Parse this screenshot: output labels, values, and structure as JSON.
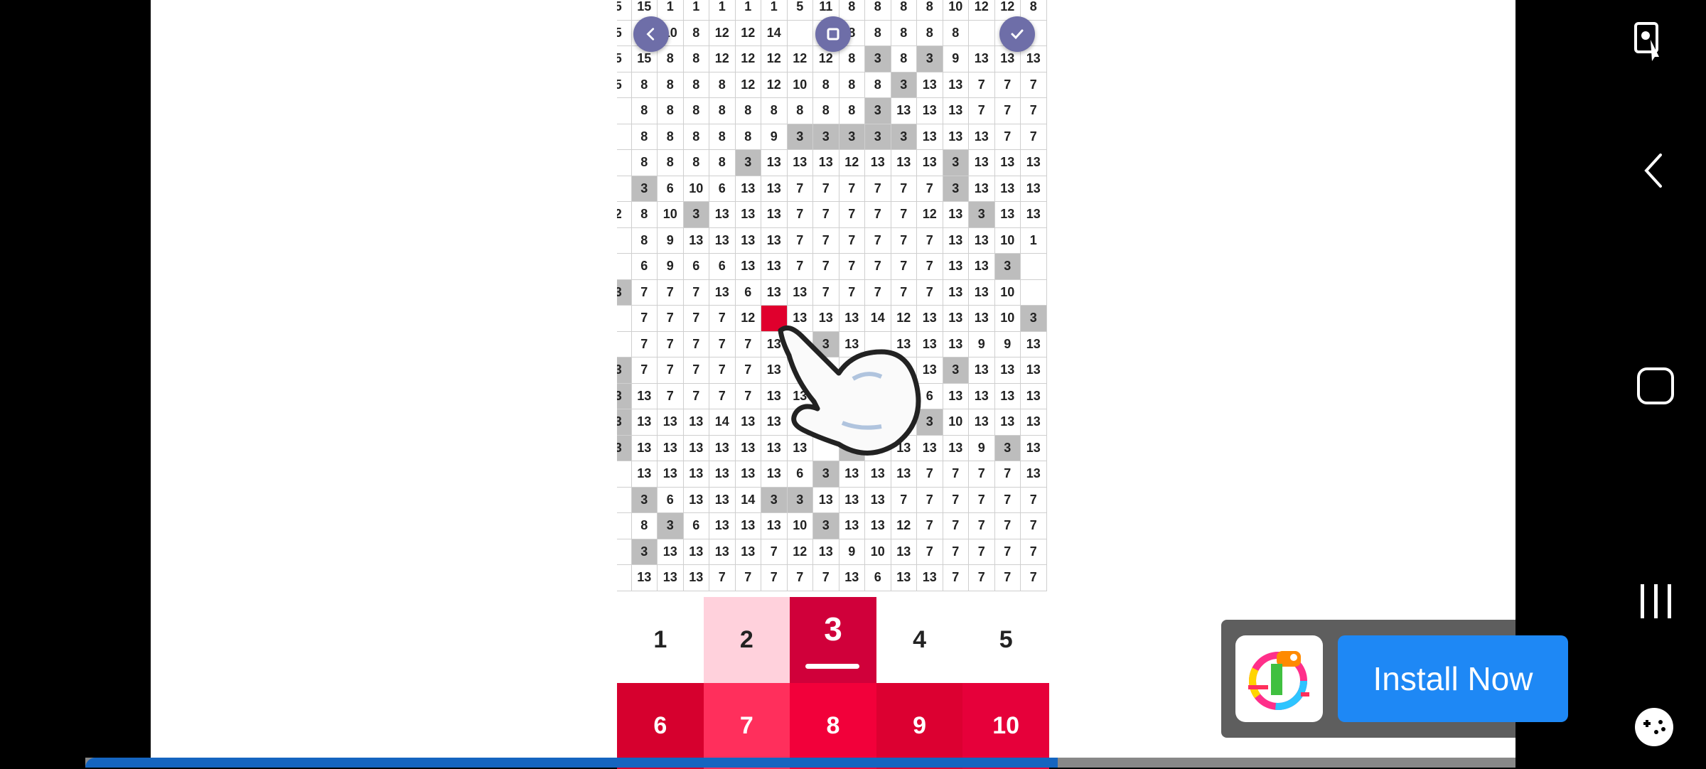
{
  "game": {
    "visible_columns": 17,
    "rows": [
      [
        "5",
        "15",
        "1",
        "1",
        "1",
        "1",
        "1",
        "5",
        "11",
        "8",
        "8",
        "8",
        "8",
        "10",
        "12",
        "12",
        "8"
      ],
      [
        "5",
        "",
        "10",
        "8",
        "12",
        "12",
        "14",
        "",
        "",
        "8",
        "8",
        "8",
        "8",
        "8",
        "",
        "",
        ""
      ],
      [
        "5",
        "15",
        "8",
        "8",
        "12",
        "12",
        "12",
        "12",
        "12",
        "8",
        "3",
        "8",
        "3",
        "9",
        "13",
        "13",
        "13"
      ],
      [
        "5",
        "8",
        "8",
        "8",
        "8",
        "12",
        "12",
        "10",
        "8",
        "8",
        "8",
        "3",
        "13",
        "13",
        "7",
        "7",
        "7"
      ],
      [
        "",
        "8",
        "8",
        "8",
        "8",
        "8",
        "8",
        "8",
        "8",
        "8",
        "3",
        "13",
        "13",
        "13",
        "7",
        "7",
        "7"
      ],
      [
        "",
        "8",
        "8",
        "8",
        "8",
        "8",
        "9",
        "3",
        "3",
        "3",
        "3",
        "3",
        "13",
        "13",
        "13",
        "7",
        "7"
      ],
      [
        "",
        "8",
        "8",
        "8",
        "8",
        "3",
        "13",
        "13",
        "13",
        "12",
        "13",
        "13",
        "13",
        "3",
        "13",
        "13",
        "13"
      ],
      [
        "",
        "3",
        "6",
        "10",
        "6",
        "13",
        "13",
        "7",
        "7",
        "7",
        "7",
        "7",
        "7",
        "3",
        "13",
        "13",
        "13"
      ],
      [
        "2",
        "8",
        "10",
        "3",
        "13",
        "13",
        "13",
        "7",
        "7",
        "7",
        "7",
        "7",
        "12",
        "13",
        "3",
        "13",
        "13"
      ],
      [
        "",
        "8",
        "9",
        "13",
        "13",
        "13",
        "13",
        "7",
        "7",
        "7",
        "7",
        "7",
        "7",
        "13",
        "13",
        "10",
        "1"
      ],
      [
        "",
        "6",
        "9",
        "6",
        "6",
        "13",
        "13",
        "7",
        "7",
        "7",
        "7",
        "7",
        "7",
        "13",
        "13",
        "3",
        ""
      ],
      [
        "3",
        "7",
        "7",
        "7",
        "13",
        "6",
        "13",
        "13",
        "7",
        "7",
        "7",
        "7",
        "7",
        "13",
        "13",
        "10",
        ""
      ],
      [
        "",
        "7",
        "7",
        "7",
        "7",
        "12",
        "",
        "13",
        "13",
        "13",
        "14",
        "12",
        "13",
        "13",
        "13",
        "10",
        "3"
      ],
      [
        "",
        "7",
        "7",
        "7",
        "7",
        "7",
        "13",
        "",
        "3",
        "13",
        "",
        "13",
        "13",
        "13",
        "9",
        "9",
        "13"
      ],
      [
        "3",
        "7",
        "7",
        "7",
        "7",
        "7",
        "13",
        "13",
        "",
        "",
        "",
        "13",
        "13",
        "3",
        "13",
        "13",
        "13"
      ],
      [
        "3",
        "13",
        "7",
        "7",
        "7",
        "7",
        "13",
        "13",
        "",
        "",
        "",
        "13",
        "6",
        "13",
        "13",
        "13",
        "13"
      ],
      [
        "3",
        "13",
        "13",
        "13",
        "14",
        "13",
        "13",
        "13",
        "",
        "",
        "",
        "13",
        "3",
        "10",
        "13",
        "13",
        "13"
      ],
      [
        "3",
        "13",
        "13",
        "13",
        "13",
        "13",
        "13",
        "13",
        "",
        "3",
        "",
        "13",
        "13",
        "13",
        "9",
        "3",
        "13"
      ],
      [
        "",
        "13",
        "13",
        "13",
        "13",
        "13",
        "13",
        "6",
        "3",
        "13",
        "13",
        "13",
        "7",
        "7",
        "7",
        "7",
        "13"
      ],
      [
        "",
        "3",
        "6",
        "13",
        "13",
        "14",
        "3",
        "3",
        "13",
        "13",
        "13",
        "7",
        "7",
        "7",
        "7",
        "7",
        "7"
      ],
      [
        "",
        "8",
        "3",
        "6",
        "13",
        "13",
        "13",
        "10",
        "3",
        "13",
        "13",
        "12",
        "7",
        "7",
        "7",
        "7",
        "7"
      ],
      [
        "",
        "3",
        "13",
        "13",
        "13",
        "13",
        "7",
        "12",
        "13",
        "9",
        "10",
        "13",
        "7",
        "7",
        "7",
        "7",
        "7"
      ],
      [
        "",
        "13",
        "13",
        "13",
        "7",
        "7",
        "7",
        "7",
        "7",
        "13",
        "6",
        "13",
        "13",
        "7",
        "7",
        "7",
        "7"
      ]
    ],
    "palette": [
      {
        "label": "1",
        "bg": "#ffffff",
        "fg": "#222222"
      },
      {
        "label": "2",
        "bg": "#ffd1dc",
        "fg": "#222222"
      },
      {
        "label": "3",
        "bg": "#d0003a",
        "fg": "#ffffff"
      },
      {
        "label": "4",
        "bg": "#ffffff",
        "fg": "#222222"
      },
      {
        "label": "5",
        "bg": "#ffffff",
        "fg": "#222222"
      },
      {
        "label": "6",
        "bg": "#d6002e",
        "fg": "#ffffff"
      },
      {
        "label": "7",
        "bg": "#ff2f5c",
        "fg": "#ffffff"
      },
      {
        "label": "8",
        "bg": "#f2003a",
        "fg": "#ffffff"
      },
      {
        "label": "9",
        "bg": "#dc0031",
        "fg": "#ffffff"
      },
      {
        "label": "10",
        "bg": "#e6003a",
        "fg": "#ffffff"
      }
    ],
    "selected_color": "3"
  },
  "ad": {
    "install_label": "Install Now",
    "progress_fraction": 0.68
  },
  "icons": {
    "back": "chevron-left-icon",
    "fullscreen": "fullscreen-icon",
    "confirm": "check-icon"
  }
}
